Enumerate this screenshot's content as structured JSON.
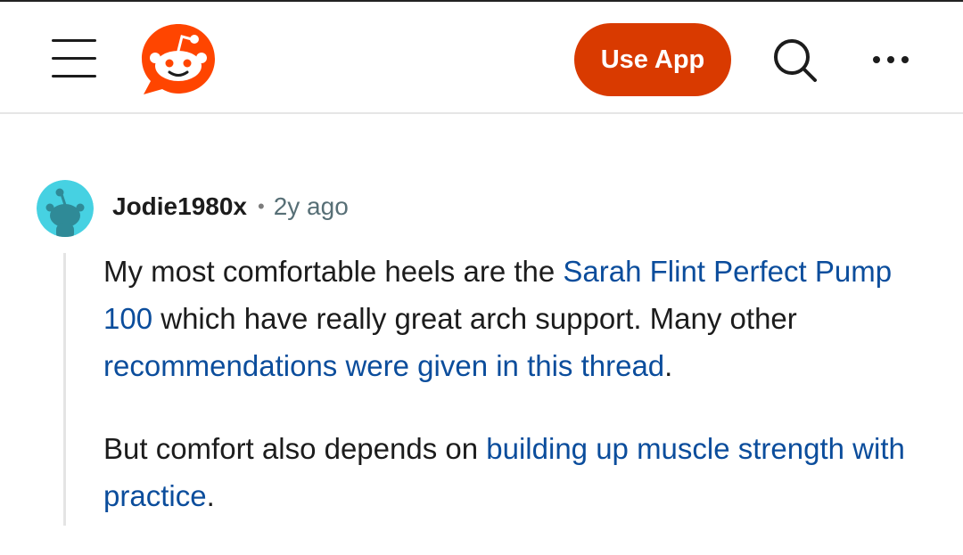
{
  "header": {
    "use_app_label": "Use App",
    "icons": {
      "menu": "hamburger-menu-icon",
      "logo": "reddit-logo",
      "search": "search-icon",
      "more": "more-options-icon"
    },
    "colors": {
      "brand": "#ff4500",
      "use_app_bg": "#d93a00"
    }
  },
  "comment": {
    "author": "Jodie1980x",
    "separator": "•",
    "time_ago": "2y ago",
    "avatar_color": "#46d1e2",
    "paragraph1": {
      "part1": "My most comfortable heels are the ",
      "link1": "Sarah Flint Perfect Pump 100",
      "part2": " which have really great arch support. Many other ",
      "link2": "recommendations were given in this thread",
      "part3": "."
    },
    "paragraph2": {
      "part1": "But comfort also depends on ",
      "link1": "building up muscle strength with practice",
      "part2": "."
    },
    "link_color": "#0b4d9c"
  }
}
